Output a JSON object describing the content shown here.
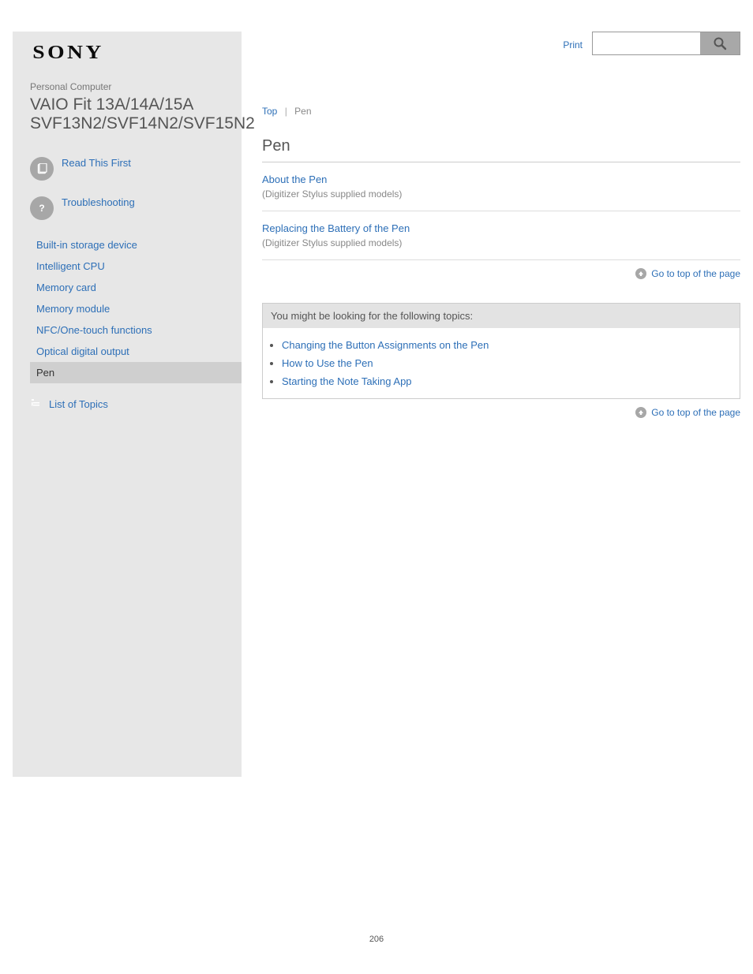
{
  "brand": "SONY",
  "product": {
    "category": "Personal Computer",
    "model": "VAIO Fit 13A/14A/15A SVF13N2/SVF14N2/SVF15N2"
  },
  "sidebar": {
    "nav": [
      {
        "label": "Read This First"
      },
      {
        "label": "Troubleshooting"
      }
    ],
    "sub": [
      {
        "label": "Built-in storage device"
      },
      {
        "label": "Intelligent CPU"
      },
      {
        "label": "Memory card"
      },
      {
        "label": "Memory module"
      },
      {
        "label": "NFC/One-touch functions"
      },
      {
        "label": "Optical digital output"
      },
      {
        "label": "Pen",
        "active": true
      }
    ],
    "contents": {
      "label": "List of Topics"
    }
  },
  "header": {
    "print_link": "Print"
  },
  "breadcrumb": {
    "a": "Top",
    "b": "Pen"
  },
  "page_title": "Pen",
  "items": [
    {
      "title": "About the Pen",
      "sub": "(Digitizer Stylus supplied models)"
    },
    {
      "title": "Replacing the Battery of the Pen",
      "sub": "(Digitizer Stylus supplied models)"
    }
  ],
  "go_top": "Go to top of the page",
  "related": {
    "heading": "You might be looking for the following topics:",
    "links": [
      "Changing the Button Assignments on the Pen",
      "How to Use the Pen",
      "Starting the Note Taking App"
    ]
  },
  "page_number": "206"
}
